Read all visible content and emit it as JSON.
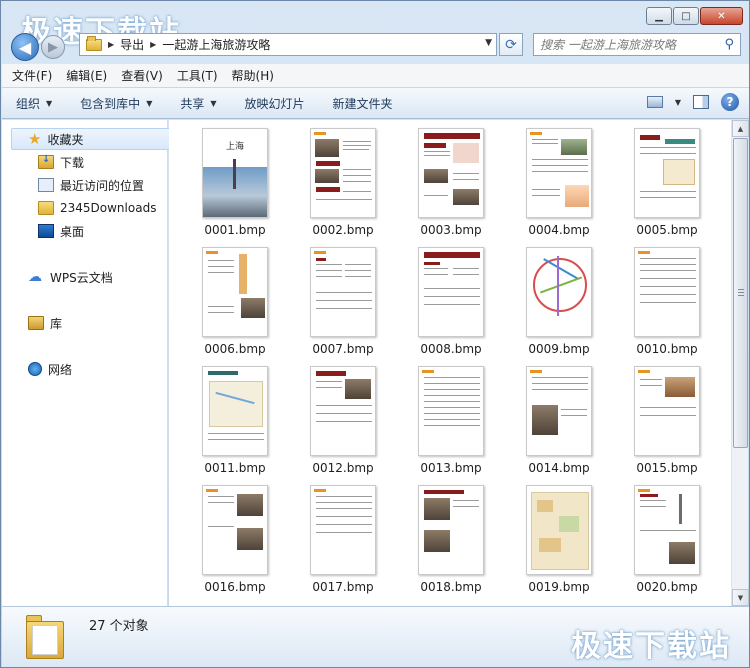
{
  "window": {
    "watermark": "极速下载站",
    "caption_minimize": "▁",
    "caption_maximize": "□",
    "caption_close": "✕"
  },
  "address": {
    "crumbs": [
      "导出",
      "一起游上海旅游攻略"
    ],
    "search_placeholder": "搜索 一起游上海旅游攻略"
  },
  "menu": [
    "文件(F)",
    "编辑(E)",
    "查看(V)",
    "工具(T)",
    "帮助(H)"
  ],
  "toolbar": {
    "organize": "组织",
    "include_library": "包含到库中",
    "share": "共享",
    "slideshow": "放映幻灯片",
    "new_folder": "新建文件夹",
    "help": "?"
  },
  "sidebar": {
    "favorites": "收藏夹",
    "favorites_items": [
      "下载",
      "最近访问的位置",
      "2345Downloads",
      "桌面"
    ],
    "wps_cloud": "WPS云文档",
    "library": "库",
    "network": "网络"
  },
  "files": [
    "0001.bmp",
    "0002.bmp",
    "0003.bmp",
    "0004.bmp",
    "0005.bmp",
    "0006.bmp",
    "0007.bmp",
    "0008.bmp",
    "0009.bmp",
    "0010.bmp",
    "0011.bmp",
    "0012.bmp",
    "0013.bmp",
    "0014.bmp",
    "0015.bmp",
    "0016.bmp",
    "0017.bmp",
    "0018.bmp",
    "0019.bmp",
    "0020.bmp"
  ],
  "cover_title": "上海",
  "details": {
    "count_text": "27 个对象"
  }
}
